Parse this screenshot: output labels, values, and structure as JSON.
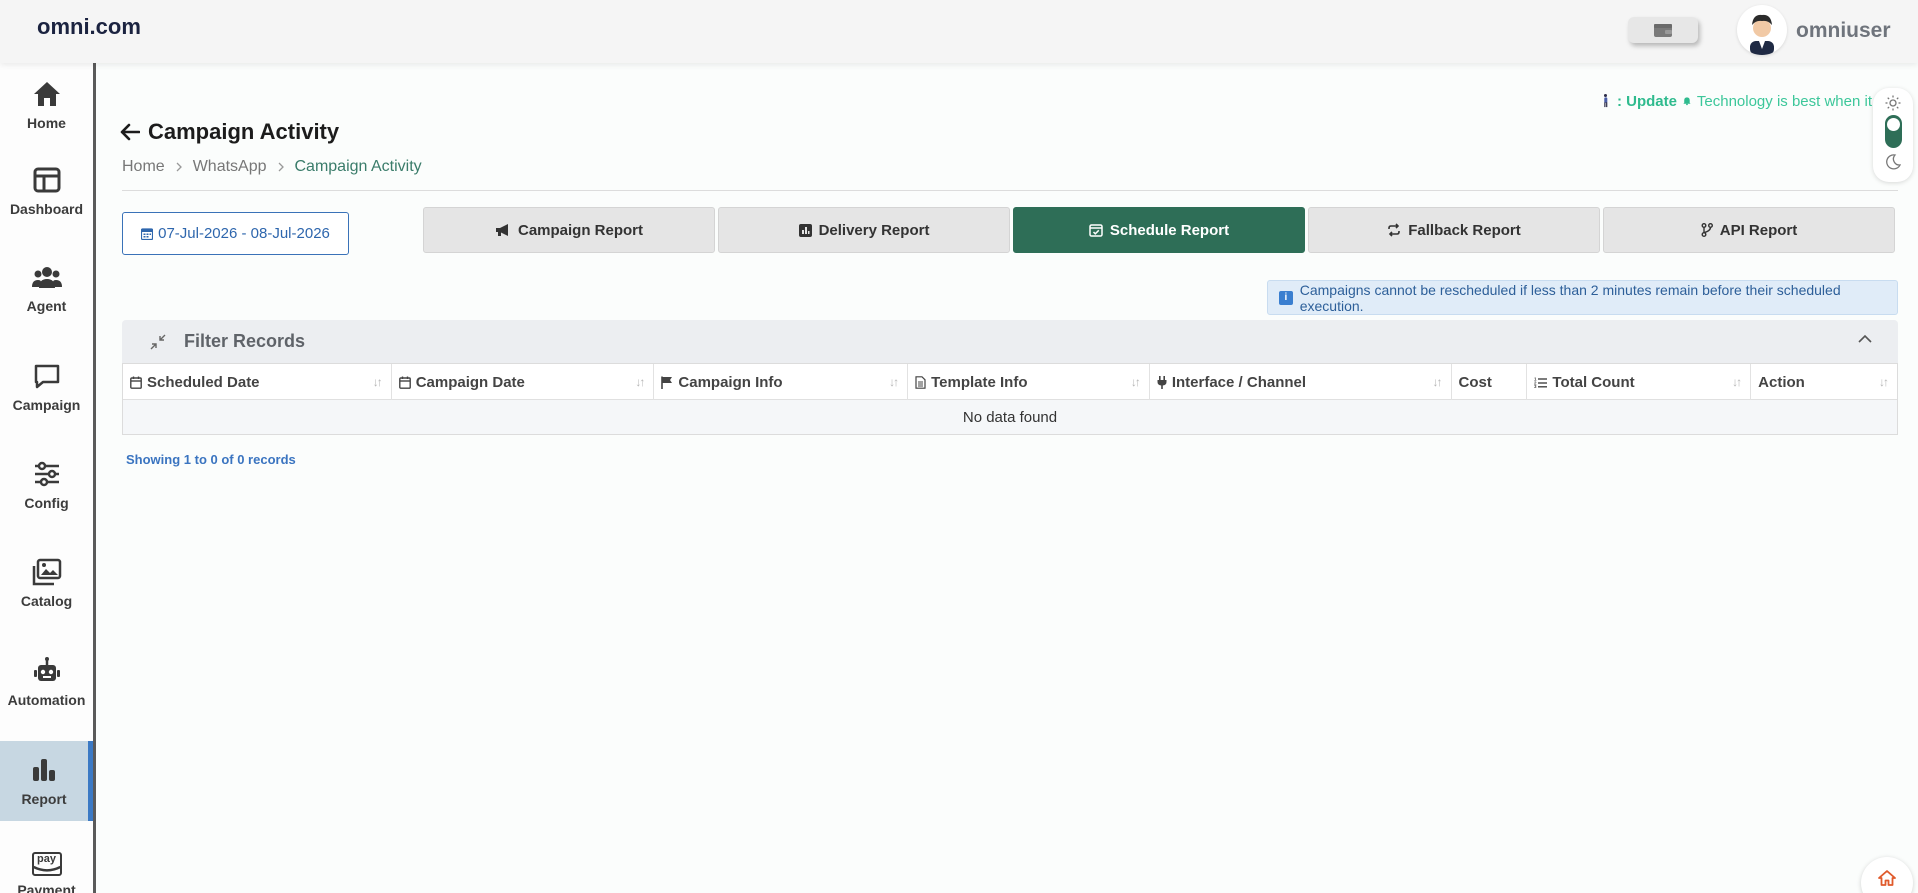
{
  "header": {
    "brand": "omni.com",
    "username": "omniuser"
  },
  "sidebar": {
    "items": [
      {
        "label": "Home",
        "icon": "home-icon"
      },
      {
        "label": "Dashboard",
        "icon": "dashboard-icon"
      },
      {
        "label": "Agent",
        "icon": "users-icon"
      },
      {
        "label": "Campaign",
        "icon": "chat-icon"
      },
      {
        "label": "Config",
        "icon": "sliders-icon"
      },
      {
        "label": "Catalog",
        "icon": "images-icon"
      },
      {
        "label": "Automation",
        "icon": "robot-icon"
      },
      {
        "label": "Report",
        "icon": "bar-chart-icon",
        "active": true
      },
      {
        "label": "Payment",
        "icon": "amazon-pay-icon",
        "badge": "pay"
      }
    ]
  },
  "ticker": {
    "prefix": ": Update",
    "text": "Technology is best when it"
  },
  "page": {
    "title": "Campaign Activity",
    "breadcrumb": [
      "Home",
      "WhatsApp",
      "Campaign Activity"
    ],
    "date_range": "07-Jul-2026 - 08-Jul-2026"
  },
  "tabs": [
    {
      "label": "Campaign Report",
      "icon": "bullhorn-icon"
    },
    {
      "label": "Delivery Report",
      "icon": "chart-square-icon"
    },
    {
      "label": "Schedule Report",
      "icon": "calendar-check-icon",
      "active": true
    },
    {
      "label": "Fallback Report",
      "icon": "repeat-icon"
    },
    {
      "label": "API Report",
      "icon": "code-branch-icon"
    }
  ],
  "notice": "Campaigns cannot be rescheduled if less than 2 minutes remain before their scheduled execution.",
  "filter": {
    "title": "Filter Records"
  },
  "table": {
    "columns": [
      {
        "label": "Scheduled Date",
        "icon": "calendar-icon",
        "sortable": true
      },
      {
        "label": "Campaign Date",
        "icon": "calendar-icon",
        "sortable": true
      },
      {
        "label": "Campaign Info",
        "icon": "flag-icon",
        "sortable": true
      },
      {
        "label": "Template Info",
        "icon": "file-icon",
        "sortable": true
      },
      {
        "label": "Interface / Channel",
        "icon": "plug-icon",
        "sortable": true
      },
      {
        "label": "Cost",
        "icon": "",
        "sortable": false
      },
      {
        "label": "Total Count",
        "icon": "list-ol-icon",
        "sortable": true
      },
      {
        "label": "Action",
        "icon": "",
        "sortable": true
      }
    ],
    "empty_text": "No data found"
  },
  "footer": {
    "showing": "Showing 1 to 0 of 0 records"
  },
  "colors": {
    "accent": "#2e6e57",
    "link": "#3a74c0",
    "sidebar_active": "#c7d7e2"
  }
}
